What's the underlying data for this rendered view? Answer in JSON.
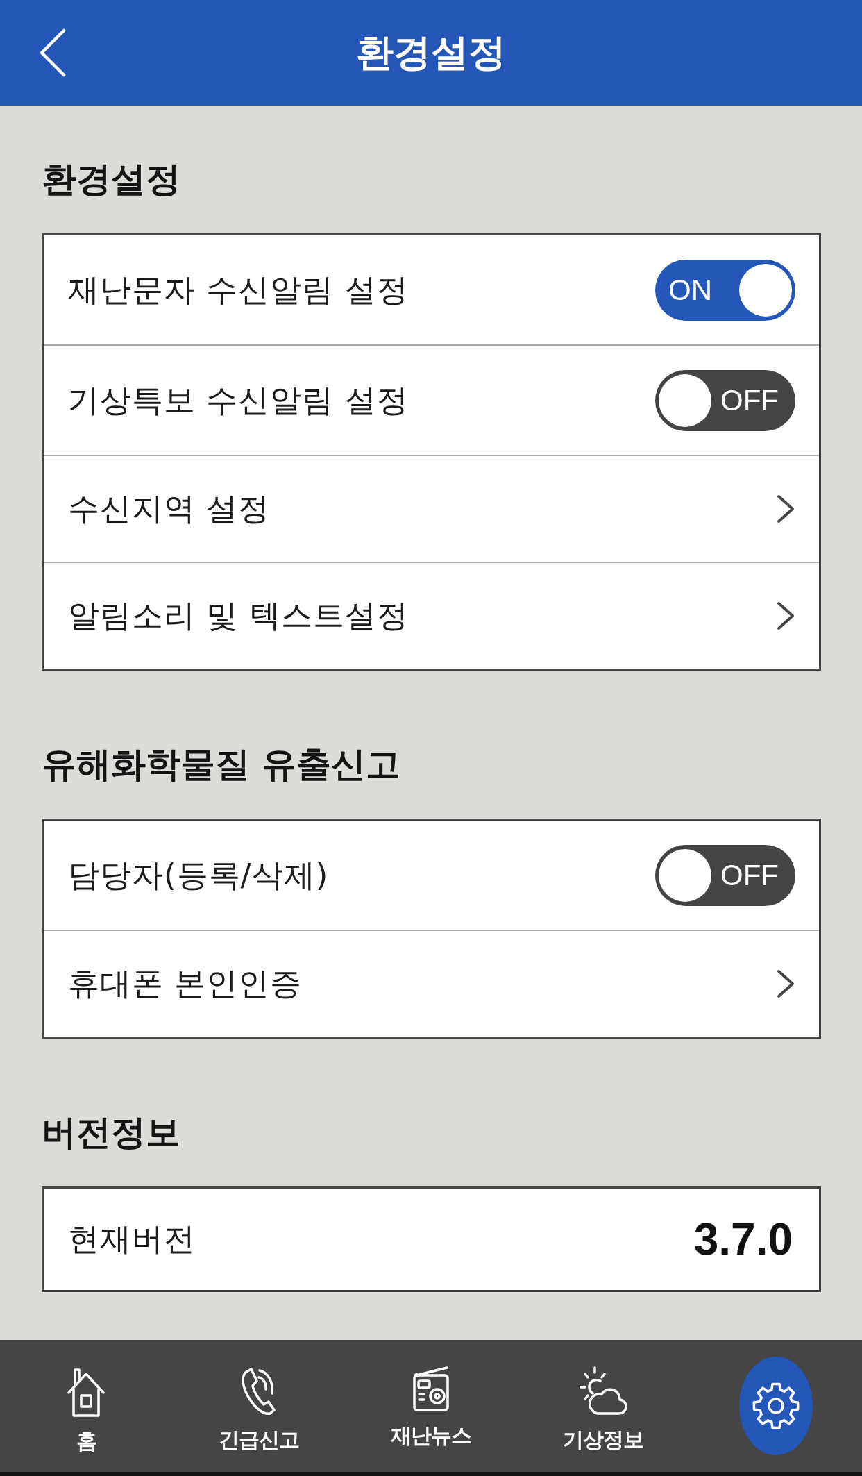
{
  "header": {
    "title": "환경설정"
  },
  "sections": [
    {
      "title": "환경설정",
      "rows": [
        {
          "kind": "toggle",
          "label": "재난문자 수신알림 설정",
          "on": true,
          "switch_text": "ON"
        },
        {
          "kind": "toggle",
          "label": "기상특보 수신알림 설정",
          "on": false,
          "switch_text": "OFF"
        },
        {
          "kind": "link",
          "label": "수신지역 설정"
        },
        {
          "kind": "link",
          "label": "알림소리 및 텍스트설정"
        }
      ]
    },
    {
      "title": "유해화학물질 유출신고",
      "rows": [
        {
          "kind": "toggle",
          "label": "담당자(등록/삭제)",
          "on": false,
          "switch_text": "OFF"
        },
        {
          "kind": "link",
          "label": "휴대폰 본인인증"
        }
      ]
    },
    {
      "title": "버전정보",
      "rows": [
        {
          "kind": "value",
          "label": "현재버전",
          "value": "3.7.0"
        }
      ]
    }
  ],
  "bottom_nav": {
    "items": [
      {
        "label": "홈",
        "selected": false
      },
      {
        "label": "긴급신고",
        "selected": false
      },
      {
        "label": "재난뉴스",
        "selected": false
      },
      {
        "label": "기상정보",
        "selected": false
      },
      {
        "selected": true
      }
    ]
  }
}
